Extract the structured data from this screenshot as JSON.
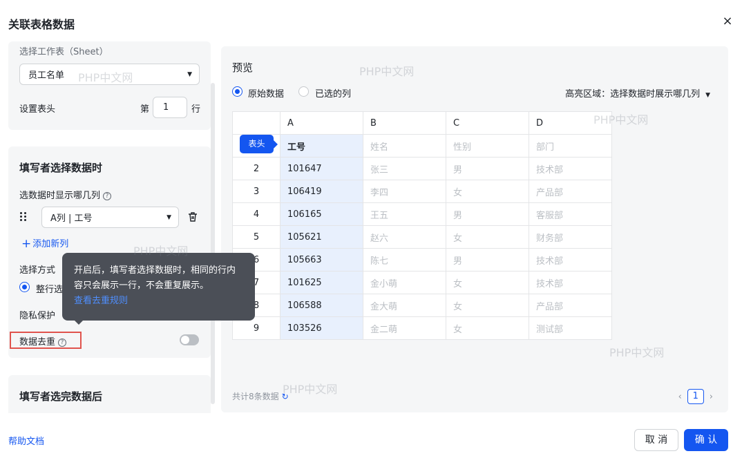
{
  "dialog": {
    "title": "关联表格数据",
    "close": "×"
  },
  "sheet": {
    "label": "选择工作表（Sheet）",
    "selected": "员工名单",
    "header_label": "设置表头",
    "prefix": "第",
    "row_value": "1",
    "suffix": "行"
  },
  "select_section": {
    "title": "填写者选择数据时",
    "show_cols_label": "选数据时显示哪几列",
    "column_selected": "A列 | 工号",
    "add_column": "添加新列",
    "mode_label": "选择方式",
    "mode_option": "整行选",
    "privacy_label": "隐私保护",
    "dedup_label": "数据去重"
  },
  "tooltip": {
    "text": "开启后，填写者选择数据时，相同的行内容只会展示一行，不会重复展示。",
    "link": "查看去重规则"
  },
  "after_section": {
    "title": "填写者选完数据后"
  },
  "preview": {
    "title": "预览",
    "radio_original": "原始数据",
    "radio_selected": "已选的列",
    "highlight": "高亮区域：选择数据时展示哪几列",
    "badge": "表头",
    "columns": [
      "A",
      "B",
      "C",
      "D"
    ],
    "header_cells": [
      "工号",
      "姓名",
      "性别",
      "部门"
    ],
    "rows": [
      {
        "n": "2",
        "id": "101647",
        "name": "张三",
        "sex": "男",
        "dept": "技术部"
      },
      {
        "n": "3",
        "id": "106419",
        "name": "李四",
        "sex": "女",
        "dept": "产品部"
      },
      {
        "n": "4",
        "id": "106165",
        "name": "王五",
        "sex": "男",
        "dept": "客服部"
      },
      {
        "n": "5",
        "id": "105621",
        "name": "赵六",
        "sex": "女",
        "dept": "财务部"
      },
      {
        "n": "6",
        "id": "105663",
        "name": "陈七",
        "sex": "男",
        "dept": "技术部"
      },
      {
        "n": "7",
        "id": "101625",
        "name": "金小萌",
        "sex": "女",
        "dept": "技术部"
      },
      {
        "n": "8",
        "id": "106588",
        "name": "金大萌",
        "sex": "女",
        "dept": "产品部"
      },
      {
        "n": "9",
        "id": "103526",
        "name": "金二萌",
        "sex": "女",
        "dept": "测试部"
      }
    ],
    "total": "共计8条数据",
    "page": "1"
  },
  "footer": {
    "help": "帮助文档",
    "cancel": "取 消",
    "ok": "确 认"
  },
  "watermark": "PHP中文网",
  "colors": {
    "primary": "#1456f0",
    "highlight": "#e8f0fd",
    "danger_outline": "#e0534d",
    "tooltip_bg": "#4b4f57"
  }
}
